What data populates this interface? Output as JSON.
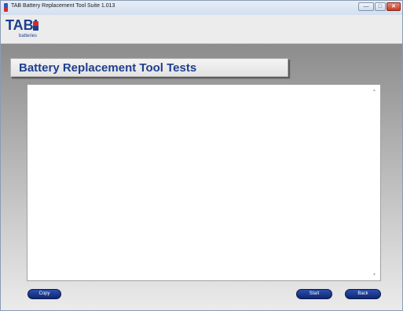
{
  "window": {
    "title": "TAB Battery Replacement Tool Suite 1.013",
    "controls": {
      "minimize_glyph": "—",
      "maximize_glyph": "□",
      "close_glyph": "✕"
    }
  },
  "header": {
    "logo_text": "TAB",
    "logo_subtext": "batteries"
  },
  "main": {
    "heading": "Battery Replacement Tool Tests",
    "log_text": "",
    "scroll_up_glyph": "▲",
    "scroll_down_glyph": "▼"
  },
  "buttons": {
    "copy_label": "Copy",
    "start_label": "Start",
    "back_label": "Back"
  },
  "colors": {
    "brand_blue": "#1e3f8f",
    "brand_red": "#d42a2a",
    "button_blue": "#1a3a8f"
  },
  "icons": {
    "app_icon": "battery-icon",
    "logo_icon": "battery-icon"
  }
}
